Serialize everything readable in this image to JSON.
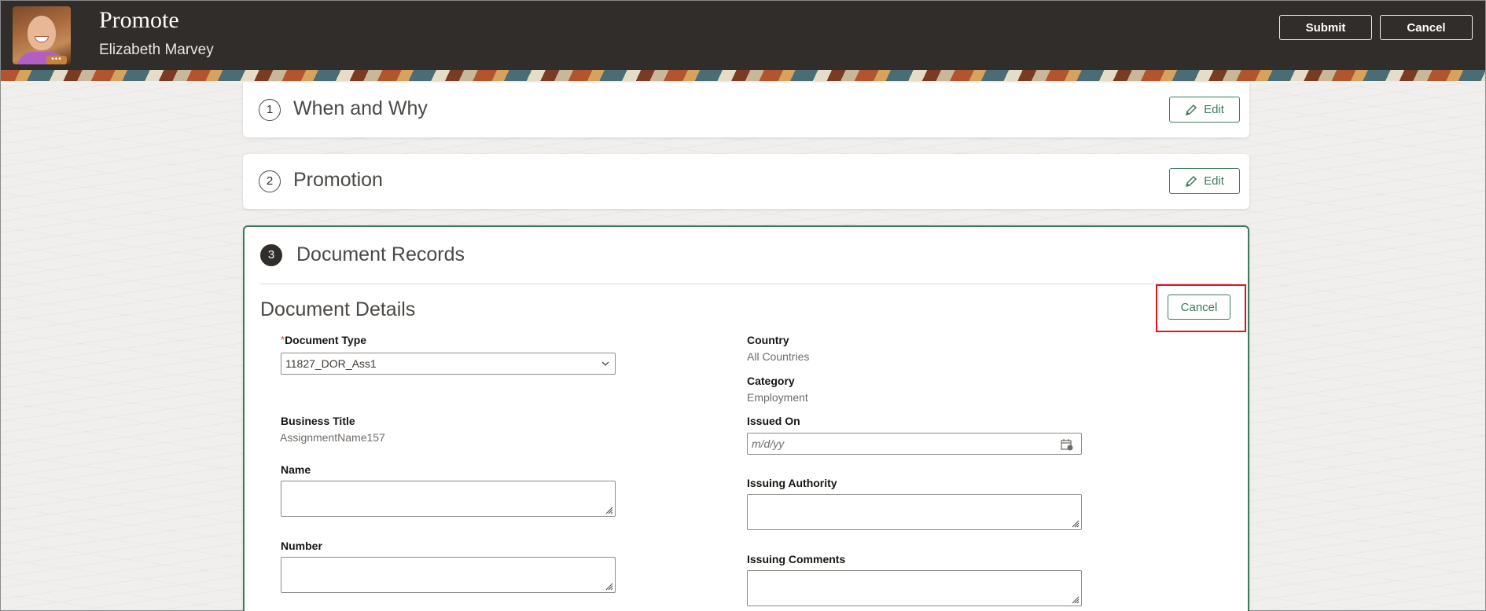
{
  "header": {
    "title": "Promote",
    "subtitle": "Elizabeth Marvey",
    "avatar_badge": "•••",
    "submit_label": "Submit",
    "cancel_label": "Cancel"
  },
  "steps": [
    {
      "number": "1",
      "title": "When and Why",
      "action_label": "Edit"
    },
    {
      "number": "2",
      "title": "Promotion",
      "action_label": "Edit"
    },
    {
      "number": "3",
      "title": "Document Records"
    }
  ],
  "document_details": {
    "title": "Document Details",
    "cancel_label": "Cancel",
    "required_marker": "*",
    "document_type": {
      "label": "Document Type",
      "value": "11827_DOR_Ass1"
    },
    "country": {
      "label": "Country",
      "value": "All Countries"
    },
    "category": {
      "label": "Category",
      "value": "Employment"
    },
    "business_title": {
      "label": "Business Title",
      "value": "AssignmentName157"
    },
    "issued_on": {
      "label": "Issued On",
      "placeholder": "m/d/yy"
    },
    "name": {
      "label": "Name",
      "value": ""
    },
    "issuing_authority": {
      "label": "Issuing Authority",
      "value": ""
    },
    "number": {
      "label": "Number",
      "value": ""
    },
    "issuing_comments": {
      "label": "Issuing Comments",
      "value": ""
    }
  },
  "colors": {
    "header_bg": "#312d2a",
    "accent_green": "#3d7a5c",
    "highlight_red": "#e0141b"
  }
}
